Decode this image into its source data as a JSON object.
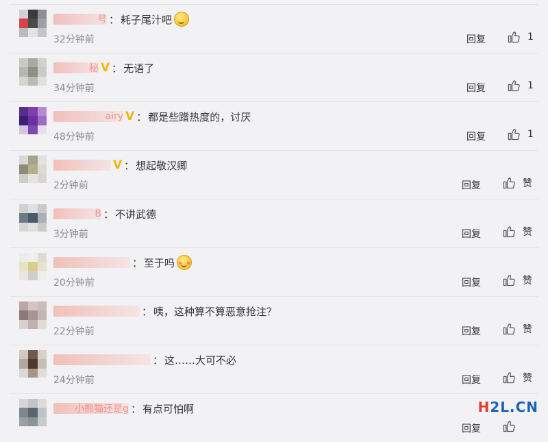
{
  "actions": {
    "reply_label": "回复",
    "like_word": "赞"
  },
  "comments": [
    {
      "name": "号",
      "vip": "",
      "text": "耗子尾汁吧",
      "emoji": "smile-emoji",
      "time": "32分钟前",
      "like": "1",
      "avatar": [
        "#cfd3d8",
        "#3b3b3b",
        "#8d8f92",
        "#d6444a",
        "#4a4a4a",
        "#9aa0a6",
        "#b7bcc2",
        "#e1e3e6",
        "#c2c6cb"
      ]
    },
    {
      "name": "秘",
      "vip": "V",
      "text": "无语了",
      "emoji": "",
      "time": "34分钟前",
      "like": "1",
      "avatar": [
        "#c7cbc4",
        "#a9ab9e",
        "#cfd1cc",
        "#b6b7ad",
        "#8e9087",
        "#c9cbc5",
        "#d3d5d0",
        "#b9bbb4",
        "#e0e1dd"
      ]
    },
    {
      "name": "airy",
      "vip": "V",
      "text": "都是些蹭热度的，讨厌",
      "emoji": "",
      "time": "48分钟前",
      "like": "1",
      "avatar": [
        "#5a2d8a",
        "#7c3fb0",
        "#b88ad6",
        "#3a1f78",
        "#6b2fa0",
        "#9c6cc6",
        "#d5c4e6",
        "#7d4ab0",
        "#e8def2"
      ]
    },
    {
      "name": "",
      "vip": "V",
      "text": "想起敬汉卿",
      "emoji": "",
      "time": "2分钟前",
      "like": "赞",
      "avatar": [
        "#d9d9d4",
        "#a8a38e",
        "#e2e1dc",
        "#8f8b78",
        "#b5ad8c",
        "#dcdad3",
        "#cfccc4",
        "#e4e3df",
        "#d8d6cf"
      ]
    },
    {
      "name": "B",
      "vip": "",
      "text": "不讲武德",
      "emoji": "",
      "time": "3分钟前",
      "like": "赞",
      "avatar": [
        "#cfd0cf",
        "#e0e0de",
        "#c9cac8",
        "#6d7a8c",
        "#4d5868",
        "#a8b0bb",
        "#d5d6d4",
        "#e1e1df",
        "#cbccca"
      ]
    },
    {
      "name": "",
      "vip": "",
      "text": "至于吗",
      "emoji": "blush-emoji",
      "time": "20分钟前",
      "like": "赞",
      "avatar": [
        "#ececea",
        "#f0efe9",
        "#dedbd0",
        "#e8e3c6",
        "#d8cf8f",
        "#e6e3d5",
        "#e7e6e2",
        "#d1cfc8",
        "#eeeeec"
      ]
    },
    {
      "name": "",
      "vip": "",
      "text": "咦，这种算不算恶意抢注？",
      "emoji": "",
      "time": "22分钟前",
      "like": "赞",
      "avatar": [
        "#b8a7a4",
        "#d2c5c1",
        "#c9bdb9",
        "#8d7a78",
        "#a69592",
        "#c4b7b3",
        "#d9cfcc",
        "#bfb1ad",
        "#e3dbd8"
      ]
    },
    {
      "name": "",
      "vip": "",
      "text": "这……大可不必",
      "emoji": "",
      "time": "24分钟前",
      "like": "赞",
      "avatar": [
        "#cfc9c3",
        "#6e5a4c",
        "#d6d0ca",
        "#b3a79b",
        "#4b3b30",
        "#c8c0b8",
        "#ddd8d3",
        "#a59688",
        "#e2ddd8"
      ]
    },
    {
      "name": "小熊猫还是g",
      "vip": "",
      "text": "有点可怕啊",
      "emoji": "",
      "time": "",
      "like": "",
      "avatar": [
        "#d6d6d4",
        "#c3c4c6",
        "#dcdcda",
        "#7f8690",
        "#5d6470",
        "#bfc2c6",
        "#9aa0a8",
        "#8d939b",
        "#c8cacc"
      ]
    }
  ],
  "watermark": {
    "h": "H",
    "rest": "2L.CN"
  }
}
